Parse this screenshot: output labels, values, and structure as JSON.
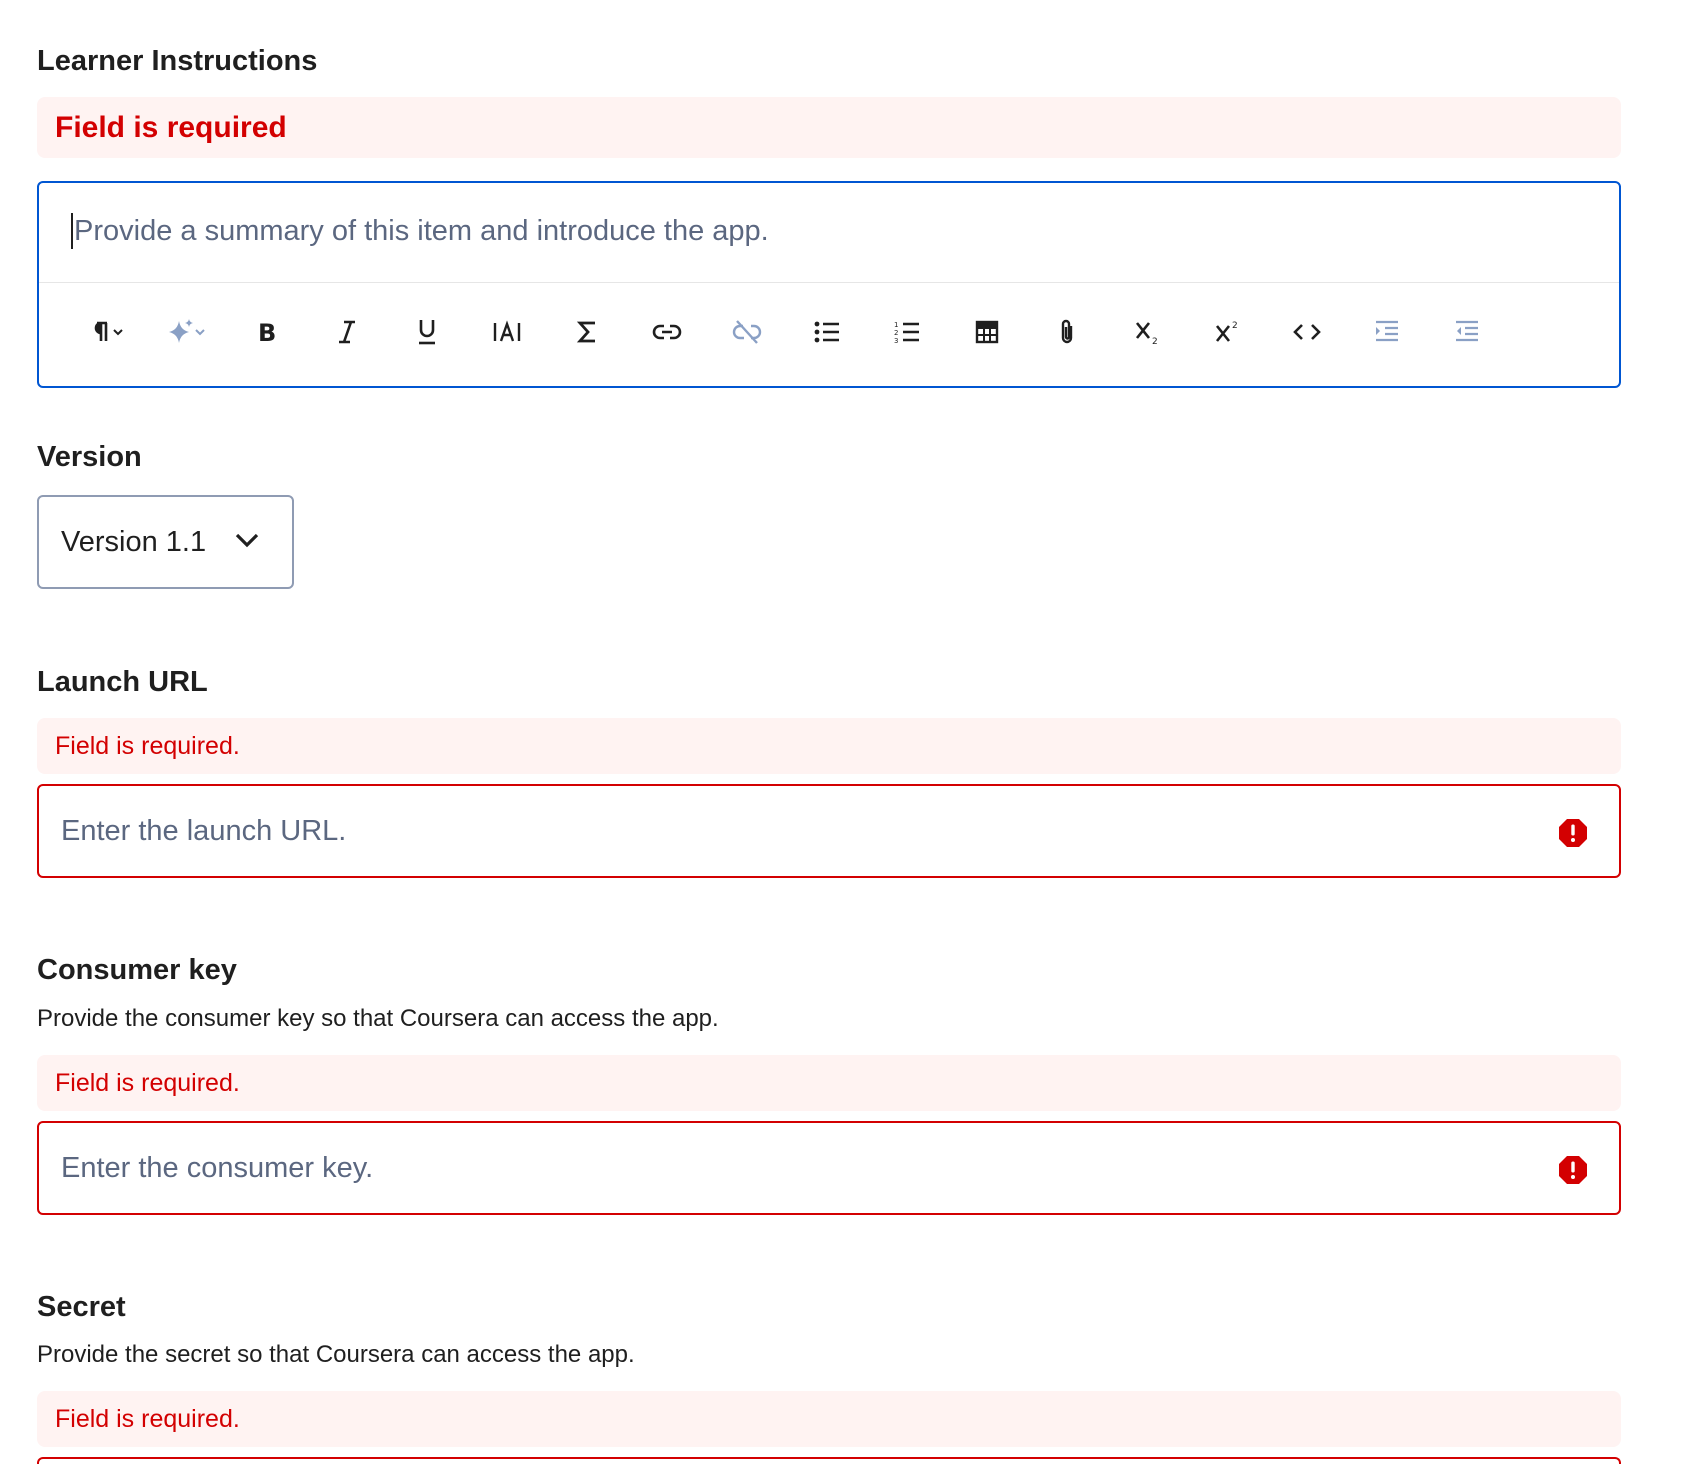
{
  "learner_instructions": {
    "label": "Learner Instructions",
    "error": "Field is required",
    "placeholder": "Provide a summary of this item and introduce the app.",
    "toolbar": [
      {
        "name": "paragraph-format-icon"
      },
      {
        "name": "ai-assist-icon"
      },
      {
        "name": "bold-icon"
      },
      {
        "name": "italic-icon"
      },
      {
        "name": "underline-icon"
      },
      {
        "name": "text-size-icon"
      },
      {
        "name": "math-sigma-icon"
      },
      {
        "name": "link-icon"
      },
      {
        "name": "unlink-icon"
      },
      {
        "name": "bulleted-list-icon"
      },
      {
        "name": "numbered-list-icon"
      },
      {
        "name": "table-icon"
      },
      {
        "name": "attachment-icon"
      },
      {
        "name": "subscript-icon"
      },
      {
        "name": "superscript-icon"
      },
      {
        "name": "code-icon"
      },
      {
        "name": "indent-icon"
      },
      {
        "name": "outdent-icon"
      }
    ]
  },
  "version": {
    "label": "Version",
    "selected": "Version 1.1"
  },
  "launch_url": {
    "label": "Launch URL",
    "error": "Field is required.",
    "placeholder": "Enter the launch URL."
  },
  "consumer_key": {
    "label": "Consumer key",
    "help": "Provide the consumer key so that Coursera can access the app.",
    "error": "Field is required.",
    "placeholder": "Enter the consumer key."
  },
  "secret": {
    "label": "Secret",
    "help": "Provide the secret so that Coursera can access the app.",
    "error": "Field is required."
  },
  "colors": {
    "primary": "#0056d2",
    "error": "#d30001",
    "error_bg": "#fff3f2",
    "placeholder": "#5b6780"
  }
}
